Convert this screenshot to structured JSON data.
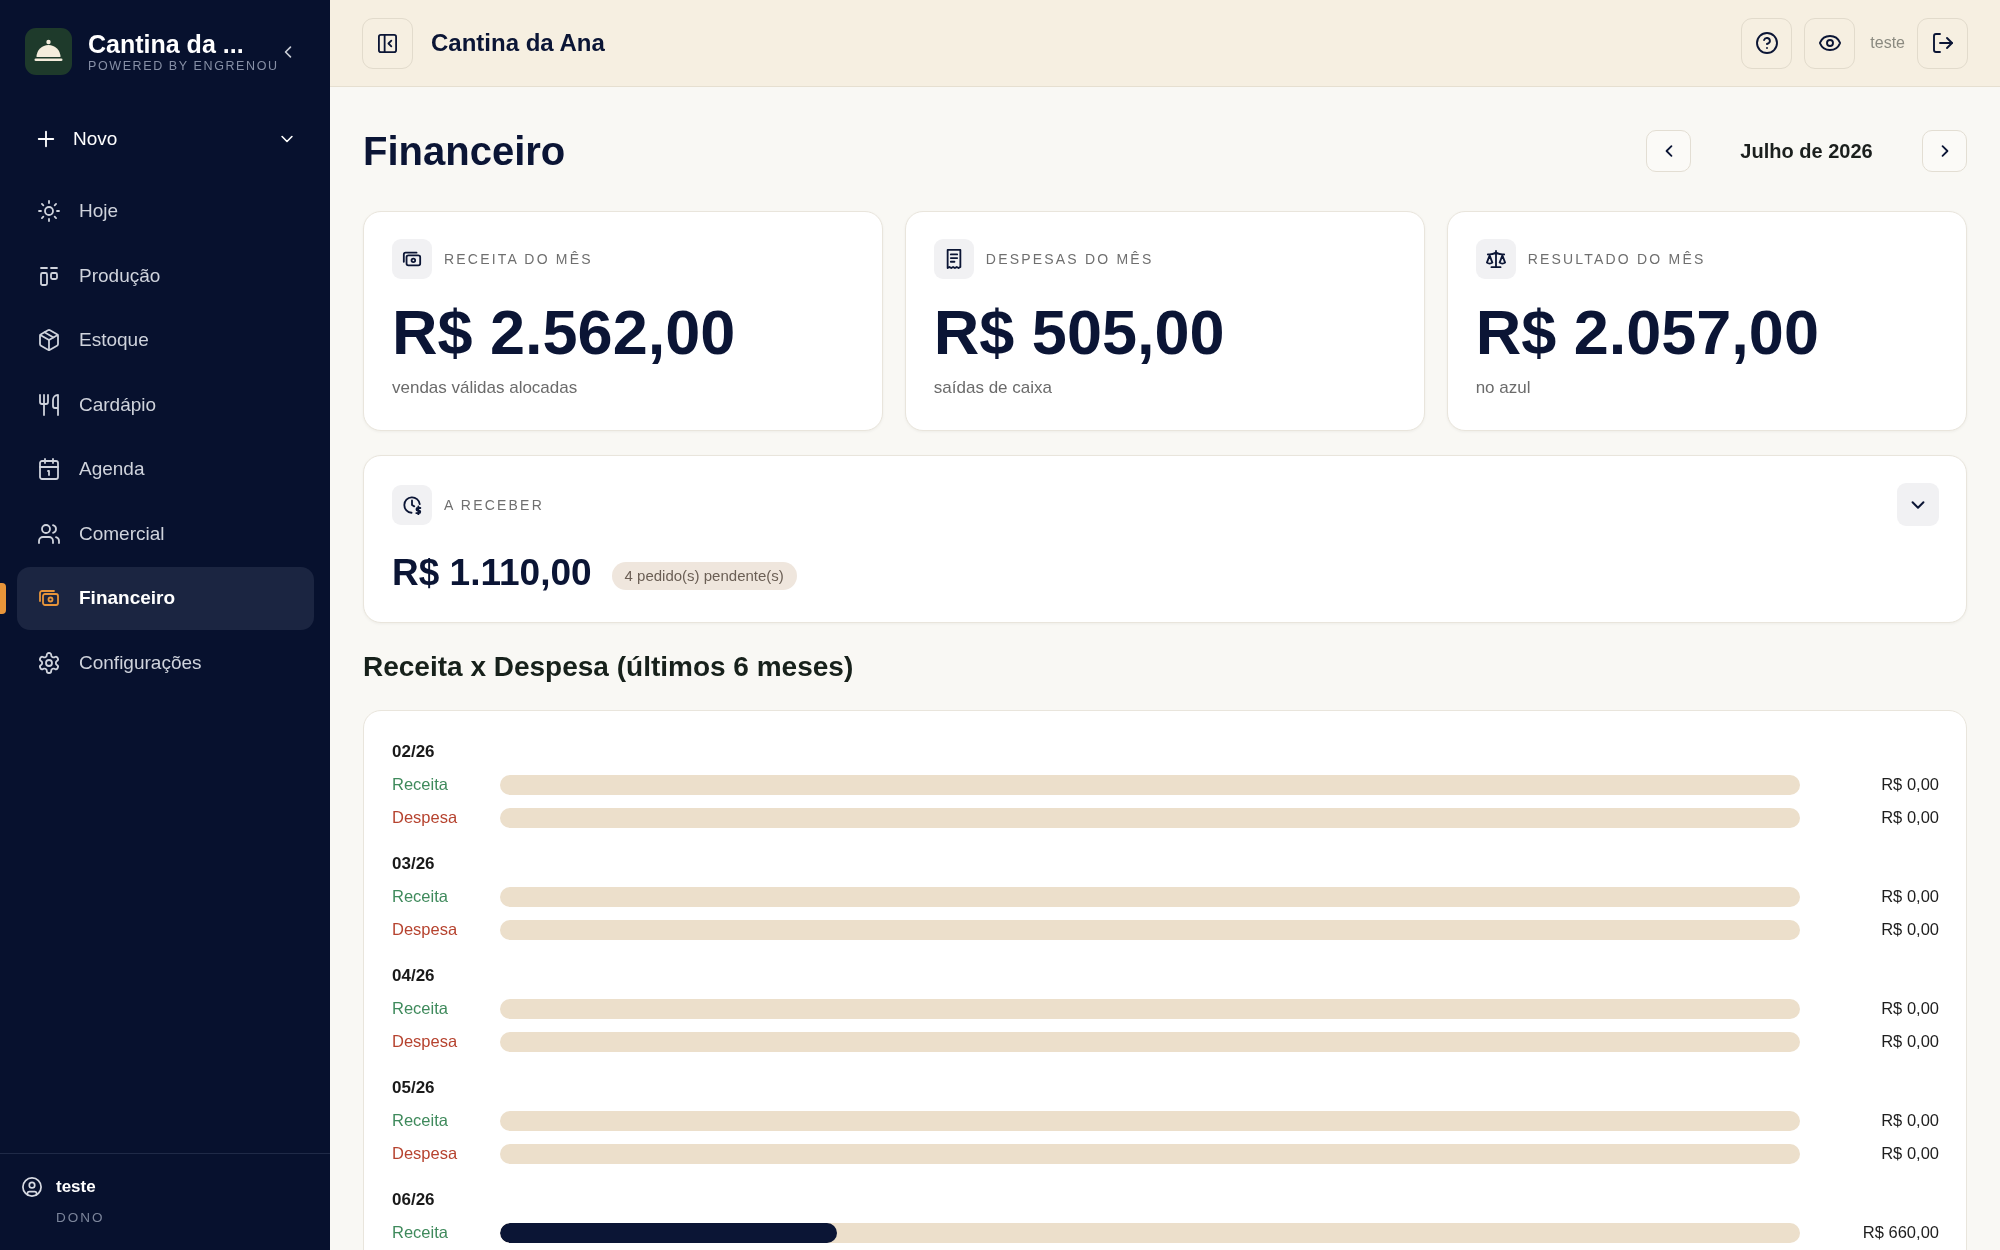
{
  "sidebar": {
    "brand": {
      "title": "Cantina da ...",
      "subtitle": "POWERED BY ENGRENOU"
    },
    "new_menu": {
      "label": "Novo"
    },
    "items": [
      {
        "label": "Hoje",
        "selected": false
      },
      {
        "label": "Produção",
        "selected": false
      },
      {
        "label": "Estoque",
        "selected": false
      },
      {
        "label": "Cardápio",
        "selected": false
      },
      {
        "label": "Agenda",
        "selected": false
      },
      {
        "label": "Comercial",
        "selected": false
      },
      {
        "label": "Financeiro",
        "selected": true
      },
      {
        "label": "Configurações",
        "selected": false
      }
    ],
    "user": {
      "name": "teste",
      "role": "DONO"
    }
  },
  "header": {
    "title": "Cantina da Ana",
    "user": "teste"
  },
  "page": {
    "title": "Financeiro",
    "period": "Julho de 2026"
  },
  "summary_cards": [
    {
      "label": "RECEITA DO MÊS",
      "value": "R$ 2.562,00",
      "caption": "vendas válidas alocadas"
    },
    {
      "label": "DESPESAS DO MÊS",
      "value": "R$ 505,00",
      "caption": "saídas de caixa"
    },
    {
      "label": "RESULTADO DO MÊS",
      "value": "R$ 2.057,00",
      "caption": "no azul"
    }
  ],
  "receivable": {
    "label": "A RECEBER",
    "value": "R$ 1.110,00",
    "badge": "4 pedido(s) pendente(s)"
  },
  "comparison": {
    "title": "Receita x Despesa (últimos 6 meses)",
    "months": [
      {
        "month": "02/26",
        "rows": [
          {
            "kind": "receita",
            "label": "Receita",
            "level": 0,
            "amount": "R$ 0,00"
          },
          {
            "kind": "despesa",
            "label": "Despesa",
            "level": 0,
            "amount": "R$ 0,00"
          }
        ]
      },
      {
        "month": "03/26",
        "rows": [
          {
            "kind": "receita",
            "label": "Receita",
            "level": 0,
            "amount": "R$ 0,00"
          },
          {
            "kind": "despesa",
            "label": "Despesa",
            "level": 0,
            "amount": "R$ 0,00"
          }
        ]
      },
      {
        "month": "04/26",
        "rows": [
          {
            "kind": "receita",
            "label": "Receita",
            "level": 0,
            "amount": "R$ 0,00"
          },
          {
            "kind": "despesa",
            "label": "Despesa",
            "level": 0,
            "amount": "R$ 0,00"
          }
        ]
      },
      {
        "month": "05/26",
        "rows": [
          {
            "kind": "receita",
            "label": "Receita",
            "level": 0,
            "amount": "R$ 0,00"
          },
          {
            "kind": "despesa",
            "label": "Despesa",
            "level": 0,
            "amount": "R$ 0,00"
          }
        ]
      },
      {
        "month": "06/26",
        "rows": [
          {
            "kind": "receita",
            "label": "Receita",
            "level": 0.259,
            "amount": "R$ 660,00"
          }
        ]
      }
    ]
  }
}
